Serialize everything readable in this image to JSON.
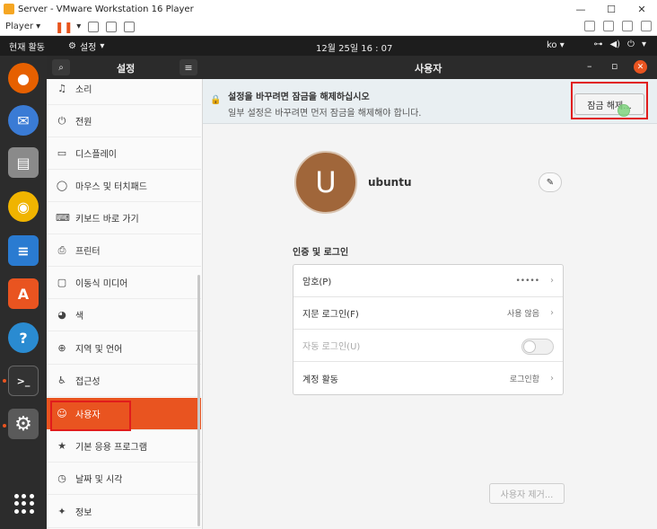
{
  "vmware": {
    "title": "Server - VMware Workstation 16 Player",
    "player_menu": "Player",
    "window_controls": [
      "—",
      "☐",
      "✕"
    ]
  },
  "topbar": {
    "activities": "현재 활동",
    "settings_menu": "설정",
    "clock": "12월 25일  16 : 07",
    "language": "ko"
  },
  "dock": {
    "apps": [
      {
        "icon": "firefox-icon",
        "color": "#e66000"
      },
      {
        "icon": "thunderbird-icon",
        "color": "#3a7bd5"
      },
      {
        "icon": "files-icon",
        "color": "#8a8a8a"
      },
      {
        "icon": "rhythmbox-icon",
        "color": "#f0b400"
      },
      {
        "icon": "writer-icon",
        "color": "#2a7bd1"
      },
      {
        "icon": "software-icon",
        "color": "#e95420"
      },
      {
        "icon": "help-icon",
        "color": "#2a8bd1"
      },
      {
        "icon": "terminal-icon",
        "color": "#333333"
      },
      {
        "icon": "settings-icon",
        "color": "#777777"
      }
    ]
  },
  "settings": {
    "header_title": "설정",
    "items": [
      {
        "label": "소리",
        "icon": "music-icon",
        "glyph": "♫"
      },
      {
        "label": "전원",
        "icon": "power-icon",
        "glyph": "⏻"
      },
      {
        "label": "디스플레이",
        "icon": "display-icon",
        "glyph": "▭"
      },
      {
        "label": "마우스 및 터치패드",
        "icon": "mouse-icon",
        "glyph": "◯"
      },
      {
        "label": "키보드 바로 가기",
        "icon": "keyboard-icon",
        "glyph": "⌨"
      },
      {
        "label": "프린터",
        "icon": "printer-icon",
        "glyph": "⎙"
      },
      {
        "label": "이동식 미디어",
        "icon": "media-icon",
        "glyph": "▢"
      },
      {
        "label": "색",
        "icon": "color-icon",
        "glyph": "◕"
      },
      {
        "label": "지역 및 언어",
        "icon": "globe-icon",
        "glyph": "⊕"
      },
      {
        "label": "접근성",
        "icon": "accessibility-icon",
        "glyph": "♿"
      },
      {
        "label": "사용자",
        "icon": "user-icon",
        "glyph": "☺"
      },
      {
        "label": "기본 응용 프로그램",
        "icon": "star-icon",
        "glyph": "★"
      },
      {
        "label": "날짜 및 시각",
        "icon": "clock-icon",
        "glyph": "◷"
      },
      {
        "label": "정보",
        "icon": "info-icon",
        "glyph": "✦"
      }
    ],
    "selected_index": 10
  },
  "users": {
    "header_title": "사용자",
    "banner_title": "설정을 바꾸려면 잠금을 해제하십시오",
    "banner_subtitle": "일부 설정은 바꾸려면 먼저 잠금을 해제해야 합니다.",
    "unlock_button": "잠금 해제...",
    "avatar_letter": "U",
    "username": "ubuntu",
    "section_title": "인증 및 로그인",
    "rows": [
      {
        "label": "암호(P)",
        "value": "•••••"
      },
      {
        "label": "지문 로그인(F)",
        "value": "사용 않음"
      },
      {
        "label": "자동 로그인(U)",
        "value": ""
      },
      {
        "label": "계정 활동",
        "value": "로그인함"
      }
    ],
    "remove_button": "사용자 제거..."
  }
}
